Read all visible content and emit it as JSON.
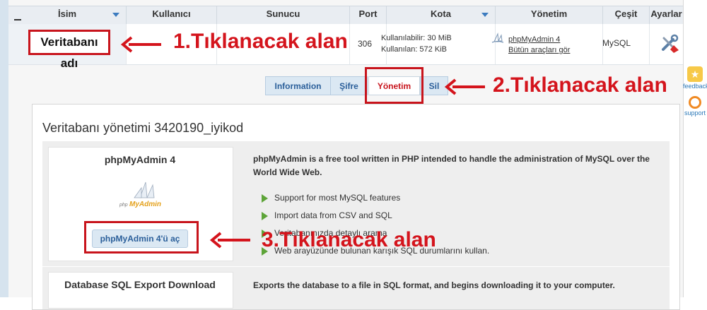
{
  "table": {
    "headers": [
      "İsim",
      "Kullanıcı",
      "Sunucu",
      "Port",
      "Kota",
      "Yönetim",
      "Çeşit",
      "Ayarlar"
    ],
    "row": {
      "name": "Veritabanı adı",
      "port_partial": "306",
      "quota_available": "Kullanılabilir:  30 MiB",
      "quota_used": "Kullanılan: 572 KiB",
      "management_link": "phpMyAdmin 4",
      "all_tools_link": "Bütün araçları gör",
      "type": "MySQL"
    }
  },
  "callouts": {
    "first": "1.Tıklanacak alan",
    "second": "2.Tıklanacak alan",
    "third": "3.Tıklanacak alan"
  },
  "tabs": [
    {
      "label": "Information"
    },
    {
      "label": "Şifre"
    },
    {
      "label": "Yönetim"
    },
    {
      "label": "Sil"
    }
  ],
  "side": {
    "feedback": "feedback",
    "support": "support"
  },
  "main": {
    "title": "Veritabanı yönetimi 3420190_iyikod",
    "card_title": "phpMyAdmin 4",
    "logo_text_php": "php",
    "logo_text_myadmin": "MyAdmin",
    "open_button": "phpMyAdmin 4'ü aç",
    "description_bold": "phpMyAdmin",
    "description_rest": " is a free tool written in PHP intended to handle the administration of MySQL over the World Wide Web.",
    "features": [
      "Support for most MySQL features",
      "Import data from CSV and SQL",
      "Veritabanınızda detaylı arama",
      "Web arayüzünde bulunan karışık SQL durumlarını kullan."
    ],
    "export_title": "Database SQL Export Download",
    "export_description": "Exports the database to a file in SQL format, and begins downloading it to your computer."
  },
  "colors": {
    "accent": "#c8141c",
    "link": "#2b5f9a",
    "tab_bg": "#dbe8f3"
  }
}
